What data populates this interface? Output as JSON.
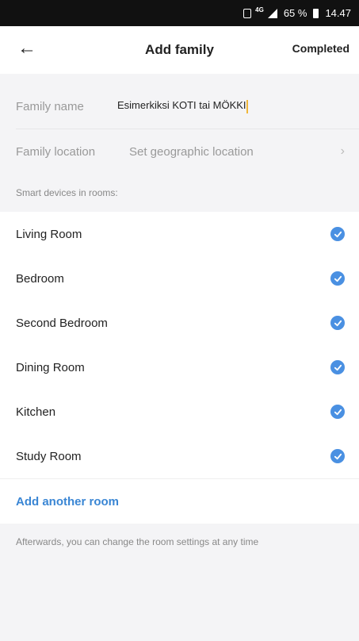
{
  "status_bar": {
    "network": "4G",
    "battery": "65 %",
    "time": "14.47"
  },
  "header": {
    "back_icon": "arrow-left-icon",
    "title": "Add family",
    "completed_label": "Completed"
  },
  "form": {
    "family_name_label": "Family name",
    "family_name_value": "Esimerkiksi KOTI tai MÖKKI",
    "family_location_label": "Family location",
    "family_location_value": "Set geographic location",
    "chevron_icon": "chevron-right-icon"
  },
  "rooms_section": {
    "label": "Smart devices in rooms:",
    "rooms": [
      {
        "name": "Living Room",
        "checked": true
      },
      {
        "name": "Bedroom",
        "checked": true
      },
      {
        "name": "Second Bedroom",
        "checked": true
      },
      {
        "name": "Dining Room",
        "checked": true
      },
      {
        "name": "Kitchen",
        "checked": true
      },
      {
        "name": "Study Room",
        "checked": true
      }
    ],
    "add_room_label": "Add another room"
  },
  "footer_note": "Afterwards, you can change the room settings at any time",
  "colors": {
    "accent": "#4a90e2",
    "link": "#3a86d4"
  }
}
